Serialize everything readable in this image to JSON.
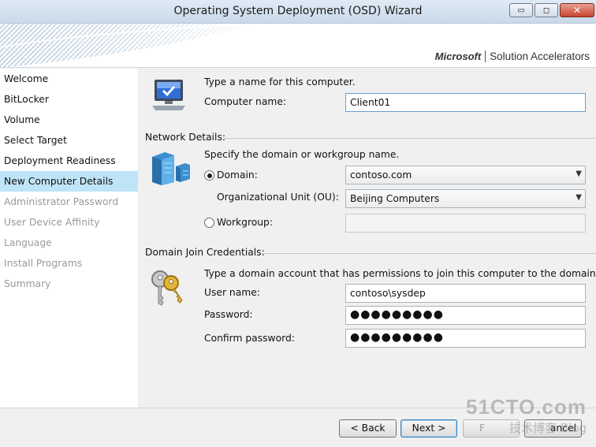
{
  "window": {
    "title": "Operating System Deployment (OSD) Wizard",
    "controls": {
      "minimize": "▭",
      "maximize": "◻",
      "close": "✕"
    }
  },
  "banner": {
    "brand_ms": "Microsoft",
    "brand_sa": "Solution Accelerators"
  },
  "sidebar": {
    "items": [
      {
        "label": "Welcome",
        "state": "normal"
      },
      {
        "label": "BitLocker",
        "state": "normal"
      },
      {
        "label": "Volume",
        "state": "normal"
      },
      {
        "label": "Select Target",
        "state": "normal"
      },
      {
        "label": "Deployment Readiness",
        "state": "normal"
      },
      {
        "label": "New Computer Details",
        "state": "active"
      },
      {
        "label": "Administrator Password",
        "state": "disabled"
      },
      {
        "label": "User Device Affinity",
        "state": "disabled"
      },
      {
        "label": "Language",
        "state": "disabled"
      },
      {
        "label": "Install Programs",
        "state": "disabled"
      },
      {
        "label": "Summary",
        "state": "disabled"
      }
    ]
  },
  "computer": {
    "prompt": "Type a name for this computer.",
    "name_label": "Computer name:",
    "name_value": "Client01"
  },
  "network": {
    "header": "Network Details:",
    "prompt": "Specify the domain or workgroup name.",
    "domain_label": "Domain:",
    "domain_value": "contoso.com",
    "ou_label": "Organizational Unit (OU):",
    "ou_value": "Beijing Computers",
    "workgroup_label": "Workgroup:",
    "workgroup_value": "",
    "selected": "domain"
  },
  "credentials": {
    "header": "Domain Join Credentials:",
    "prompt": "Type a domain account that has permissions to join this computer to the domain.",
    "username_label": "User name:",
    "username_value": "contoso\\sysdep",
    "password_label": "Password:",
    "password_value": "●●●●●●●●●",
    "confirm_label": "Confirm password:",
    "confirm_value": "●●●●●●●●●"
  },
  "footer": {
    "back_label": "< Back",
    "next_label": "Next >",
    "finish_label": "F",
    "cancel_label": "ancel"
  },
  "watermark": {
    "line1": "51CTO.com",
    "line2": "技术博客",
    "line3": "Blog"
  },
  "colors": {
    "active_item": "#bfe3f7",
    "disabled_text": "#9a9a9a"
  }
}
